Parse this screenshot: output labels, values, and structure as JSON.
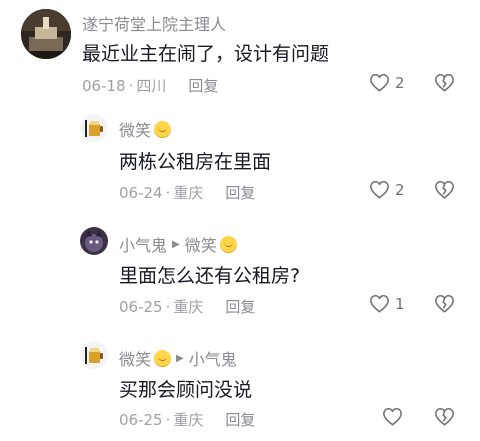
{
  "comments": [
    {
      "author": "遂宁荷堂上院主理人",
      "text": "最近业主在闹了，设计有问题",
      "date": "06-18",
      "location": "四川",
      "reply_label": "回复",
      "likes": "2"
    },
    {
      "author": "微笑",
      "text": "两栋公租房在里面",
      "date": "06-24",
      "location": "重庆",
      "reply_label": "回复",
      "likes": "2"
    },
    {
      "author": "小气鬼",
      "reply_to": "微笑",
      "text": "里面怎么还有公租房?",
      "date": "06-25",
      "location": "重庆",
      "reply_label": "回复",
      "likes": "1"
    },
    {
      "author": "微笑",
      "reply_to": "小气鬼",
      "text": "买那会顾问没说",
      "date": "06-25",
      "location": "重庆",
      "reply_label": "回复",
      "likes": ""
    }
  ],
  "separator": "·",
  "icons": {
    "like": "heart-outline-icon",
    "dislike": "broken-heart-icon",
    "reply_arrow": "triangle-right-icon",
    "emoji": "smile-emoji-icon"
  },
  "colors": {
    "text": "#161823",
    "secondary": "#8a8b91",
    "meta": "#a0a1a6"
  }
}
